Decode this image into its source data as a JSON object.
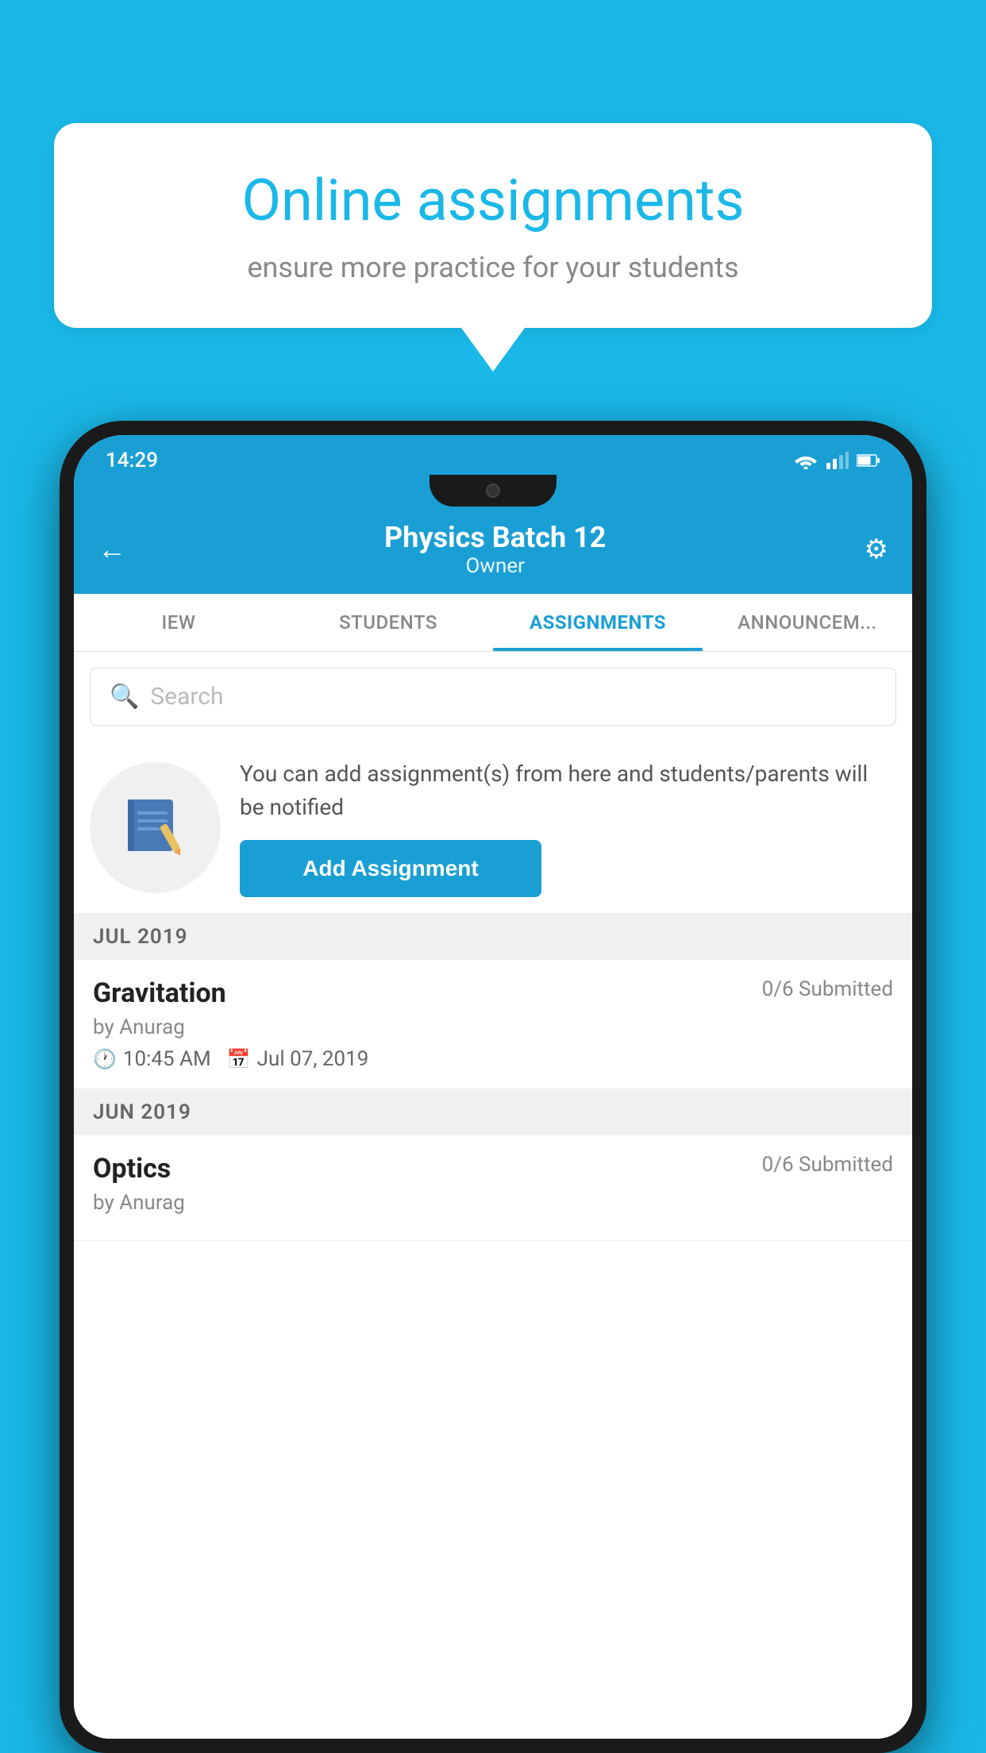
{
  "background_color": "#1ab8e8",
  "speech_bubble": {
    "title": "Online assignments",
    "subtitle": "ensure more practice for your students"
  },
  "status_bar": {
    "time": "14:29",
    "wifi_icon": "wifi",
    "signal_icon": "signal",
    "battery_icon": "battery"
  },
  "header": {
    "title": "Physics Batch 12",
    "subtitle": "Owner",
    "back_label": "←",
    "settings_label": "⚙"
  },
  "tabs": [
    {
      "label": "IEW",
      "active": false
    },
    {
      "label": "STUDENTS",
      "active": false
    },
    {
      "label": "ASSIGNMENTS",
      "active": true
    },
    {
      "label": "ANNOUNCEM...",
      "active": false
    }
  ],
  "search": {
    "placeholder": "Search",
    "icon": "🔍"
  },
  "promo": {
    "description": "You can add assignment(s) from here and students/parents will be notified",
    "button_label": "Add Assignment"
  },
  "sections": [
    {
      "label": "JUL 2019",
      "assignments": [
        {
          "name": "Gravitation",
          "submitted": "0/6 Submitted",
          "by": "by Anurag",
          "time": "10:45 AM",
          "date": "Jul 07, 2019"
        }
      ]
    },
    {
      "label": "JUN 2019",
      "assignments": [
        {
          "name": "Optics",
          "submitted": "0/6 Submitted",
          "by": "by Anurag",
          "time": "",
          "date": ""
        }
      ]
    }
  ]
}
